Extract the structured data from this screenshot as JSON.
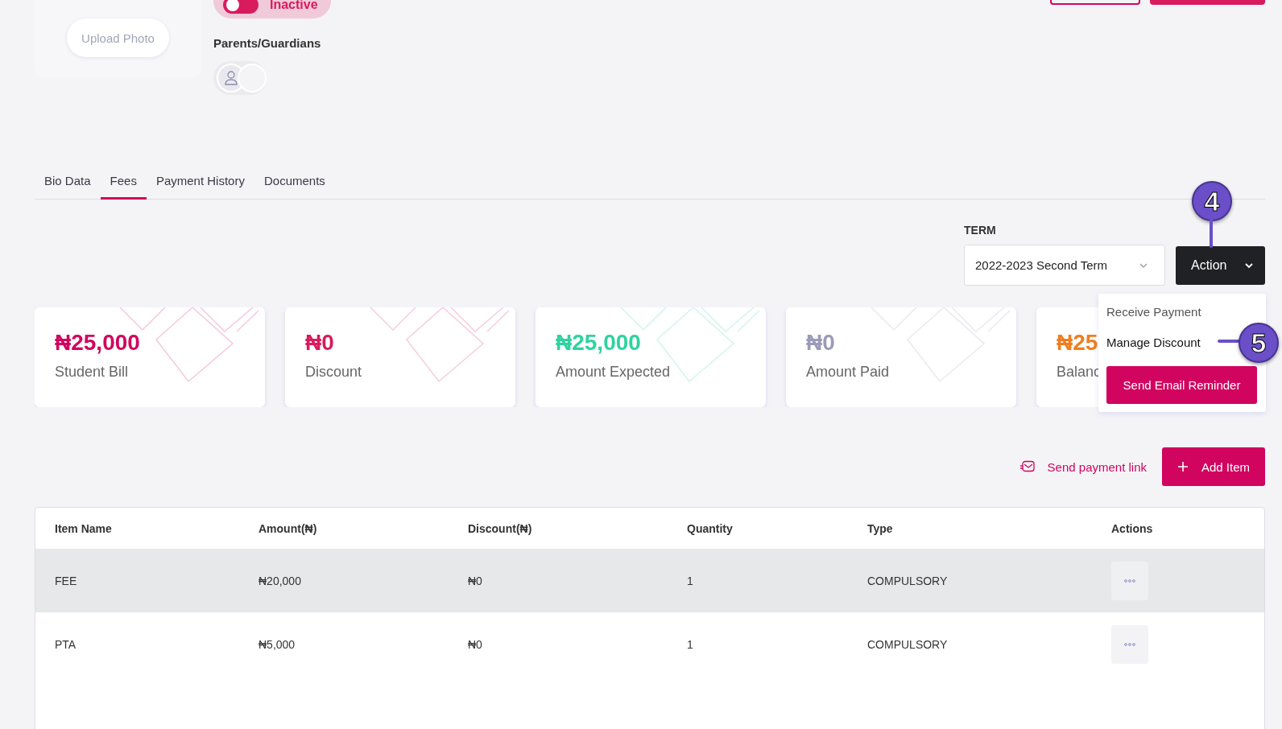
{
  "profile": {
    "upload_button": "Upload Photo",
    "status": {
      "label": "Inactive",
      "on": false
    },
    "parents_label": "Parents/Guardians"
  },
  "tabs": [
    {
      "label": "Bio Data",
      "selected": false
    },
    {
      "label": "Fees",
      "selected": true
    },
    {
      "label": "Payment History",
      "selected": false
    },
    {
      "label": "Documents",
      "selected": false
    }
  ],
  "term": {
    "label": "TERM",
    "value": "2022-2023 Second Term"
  },
  "action_button": "Action",
  "action_menu": [
    {
      "label": "Receive Payment",
      "kind": "muted"
    },
    {
      "label": "Manage Discount",
      "kind": "item"
    },
    {
      "label": "Send Email Reminder",
      "kind": "button"
    }
  ],
  "annotations": [
    {
      "number": "4"
    },
    {
      "number": "5"
    }
  ],
  "stats": [
    {
      "amount": "₦25,000",
      "label": "Student Bill",
      "color": "#d1045f"
    },
    {
      "amount": "₦0",
      "label": "Discount",
      "color": "#d81b5c"
    },
    {
      "amount": "₦25,000",
      "label": "Amount Expected",
      "color": "#2ed39e"
    },
    {
      "amount": "₦0",
      "label": "Amount Paid",
      "color": "#9a9bb8"
    },
    {
      "amount": "₦25",
      "label": "Balanc",
      "color": "#f07e1f"
    }
  ],
  "send_link": "Send payment link",
  "add_item": "Add Item",
  "table": {
    "columns": [
      "Item Name",
      "Amount(₦)",
      "Discount(₦)",
      "Quantity",
      "Type",
      "Actions"
    ],
    "rows": [
      {
        "cells": [
          "FEE",
          "₦20,000",
          "₦0",
          "1",
          "COMPULSORY"
        ],
        "highlighted": true
      },
      {
        "cells": [
          "PTA",
          "₦5,000",
          "₦0",
          "1",
          "COMPULSORY"
        ],
        "highlighted": false
      }
    ]
  }
}
